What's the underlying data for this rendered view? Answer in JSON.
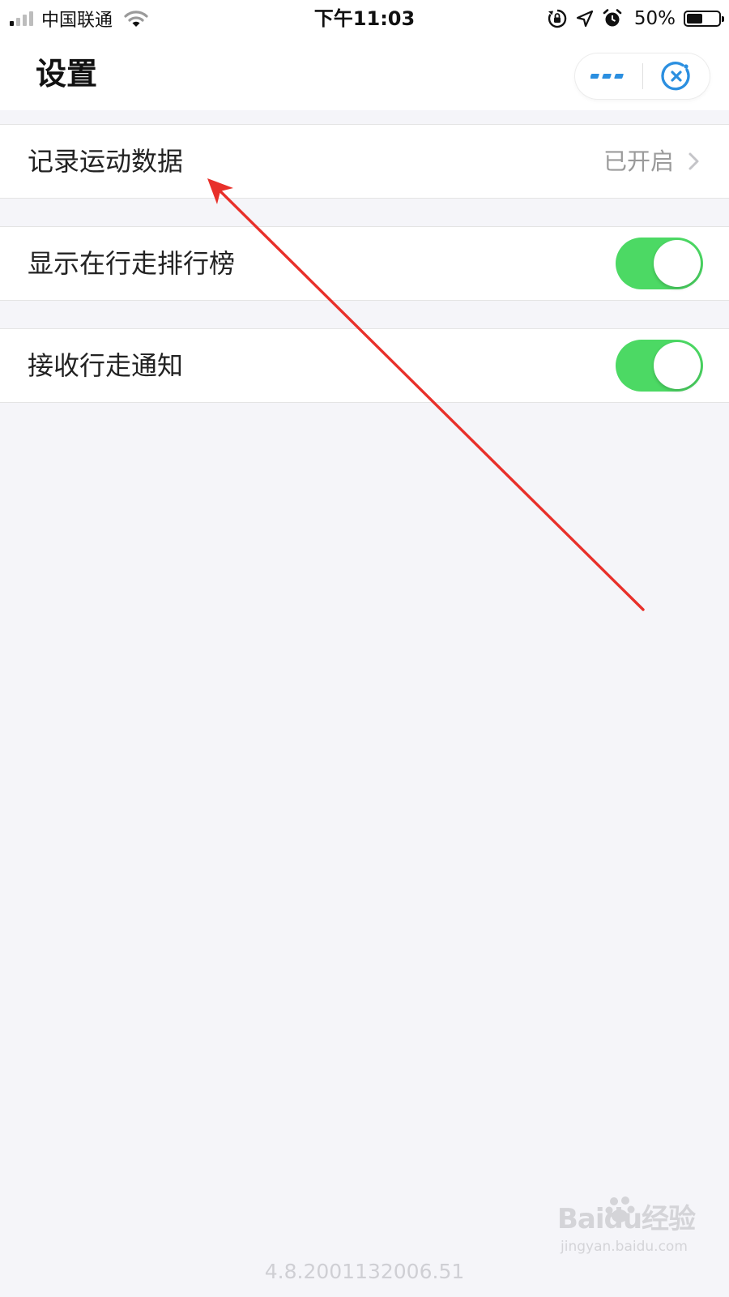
{
  "status_bar": {
    "carrier": "中国联通",
    "time": "下午11:03",
    "battery_percent": "50%",
    "battery_level": 0.5,
    "icons": [
      "signal-icon",
      "wifi-icon",
      "orientation-lock-icon",
      "location-icon",
      "alarm-icon",
      "battery-icon"
    ]
  },
  "header": {
    "title": "设置",
    "capsule_icons": [
      "more-icon",
      "close-icon"
    ]
  },
  "settings": {
    "record_sport": {
      "label": "记录运动数据",
      "value": "已开启"
    },
    "show_ranking": {
      "label": "显示在行走排行榜",
      "enabled": true
    },
    "receive_notice": {
      "label": "接收行走通知",
      "enabled": true
    }
  },
  "footer": {
    "version": "4.8.2001132006.51"
  },
  "watermark": {
    "brand": "Baidu经验",
    "sub": "jingyan.baidu.com"
  },
  "colors": {
    "toggle_on": "#4cd964",
    "accent_blue": "#2b8fe0",
    "annotation_red": "#e8302a",
    "background": "#f5f5f9"
  }
}
